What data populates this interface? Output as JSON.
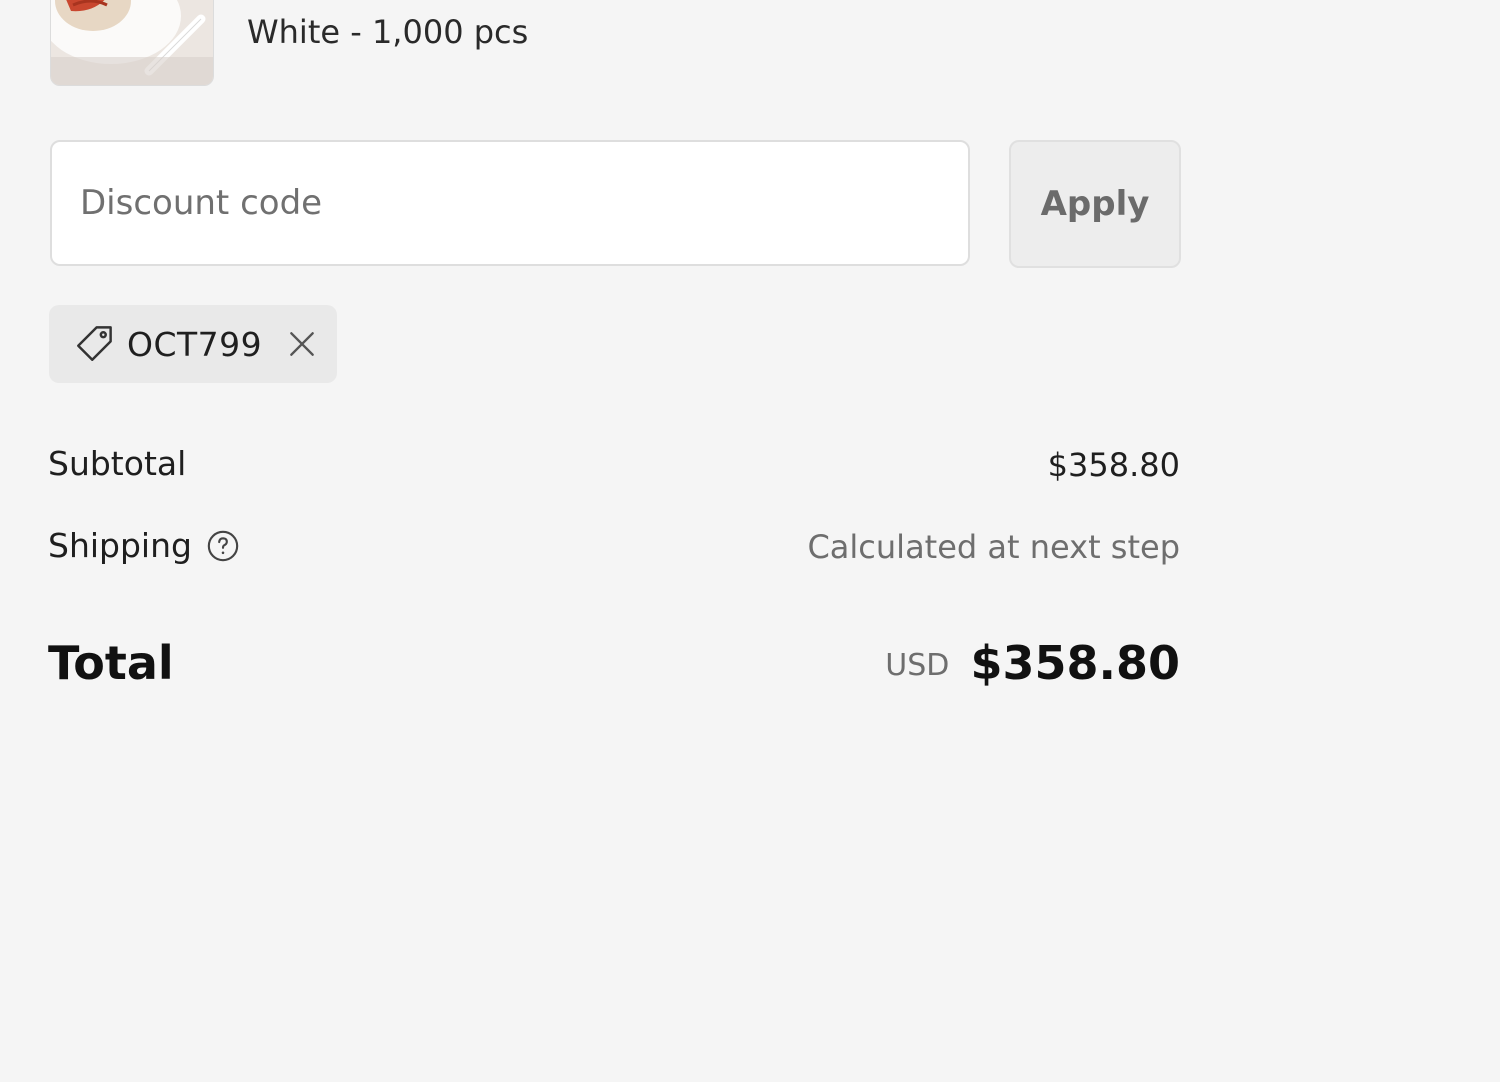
{
  "product": {
    "variant": "White - 1,000 pcs",
    "thumbnail_icon": "product-image"
  },
  "discount": {
    "placeholder": "Discount code",
    "value": "",
    "apply_label": "Apply"
  },
  "applied_code": {
    "code": "OCT799",
    "tag_icon": "tag-icon",
    "remove_icon": "close-icon"
  },
  "summary": {
    "subtotal_label": "Subtotal",
    "subtotal_value": "$358.80",
    "shipping_label": "Shipping",
    "shipping_value": "Calculated at next step",
    "total_label": "Total",
    "currency": "USD",
    "total_value": "$358.80"
  },
  "colors": {
    "background": "#f5f5f5",
    "chip": "#e9e9e9",
    "button": "#ededed"
  }
}
